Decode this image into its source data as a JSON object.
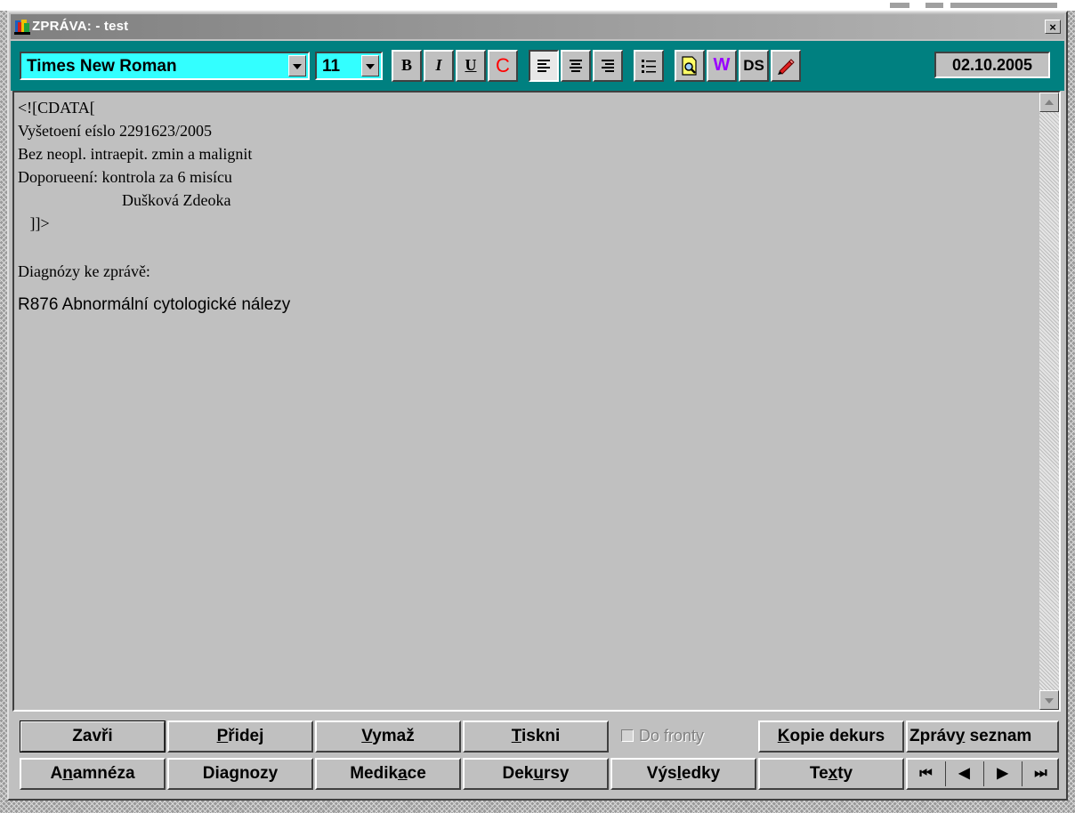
{
  "window": {
    "title": "ZPRÁVA: - test",
    "close_label": "×"
  },
  "toolbar": {
    "font_name": "Times New Roman",
    "font_size": "11",
    "bold_label": "B",
    "italic_label": "I",
    "underline_label": "U",
    "color_label": "C",
    "color_accent": "#ff0000",
    "w_label": "W",
    "w_accent": "#9900ff",
    "ds_label": "DS",
    "date": "02.10.2005"
  },
  "editor": {
    "lines": [
      "<![CDATA[",
      "Vyšetoení eíslo 2291623/2005",
      "Bez neopl. intraepit. zmin a malignit",
      "Doporueení: kontrola za 6 misícu",
      "",
      "                          Dušková Zdeoka",
      "   ]]>",
      "",
      "Diagnózy ke zprávě:"
    ],
    "diagnosis_line": "R876 Abnormální cytologické nálezy"
  },
  "buttons_row1": [
    {
      "pre": "Zavři",
      "ul": "",
      "post": ""
    },
    {
      "pre": "",
      "ul": "P",
      "post": "řidej"
    },
    {
      "pre": "",
      "ul": "V",
      "post": "ymaž"
    },
    {
      "pre": "",
      "ul": "T",
      "post": "iskni"
    },
    {
      "pre": "",
      "ul": "K",
      "post": "opie dekurs"
    },
    {
      "pre": "Zpráv",
      "ul": "y",
      "post": " seznam"
    }
  ],
  "queue_checkbox": {
    "label": "Do fronty",
    "checked": false
  },
  "buttons_row2": [
    {
      "pre": "A",
      "ul": "n",
      "post": "amnéza"
    },
    {
      "pre": "Dia",
      "ul": "g",
      "post": "nozy"
    },
    {
      "pre": "Medik",
      "ul": "a",
      "post": "ce"
    },
    {
      "pre": "Dek",
      "ul": "u",
      "post": "rsy"
    },
    {
      "pre": "Výs",
      "ul": "l",
      "post": "edky"
    },
    {
      "pre": "Te",
      "ul": "x",
      "post": "ty"
    }
  ],
  "nav": {
    "first": "⏮",
    "prev": "◀",
    "next": "▶",
    "last": "⏭"
  }
}
